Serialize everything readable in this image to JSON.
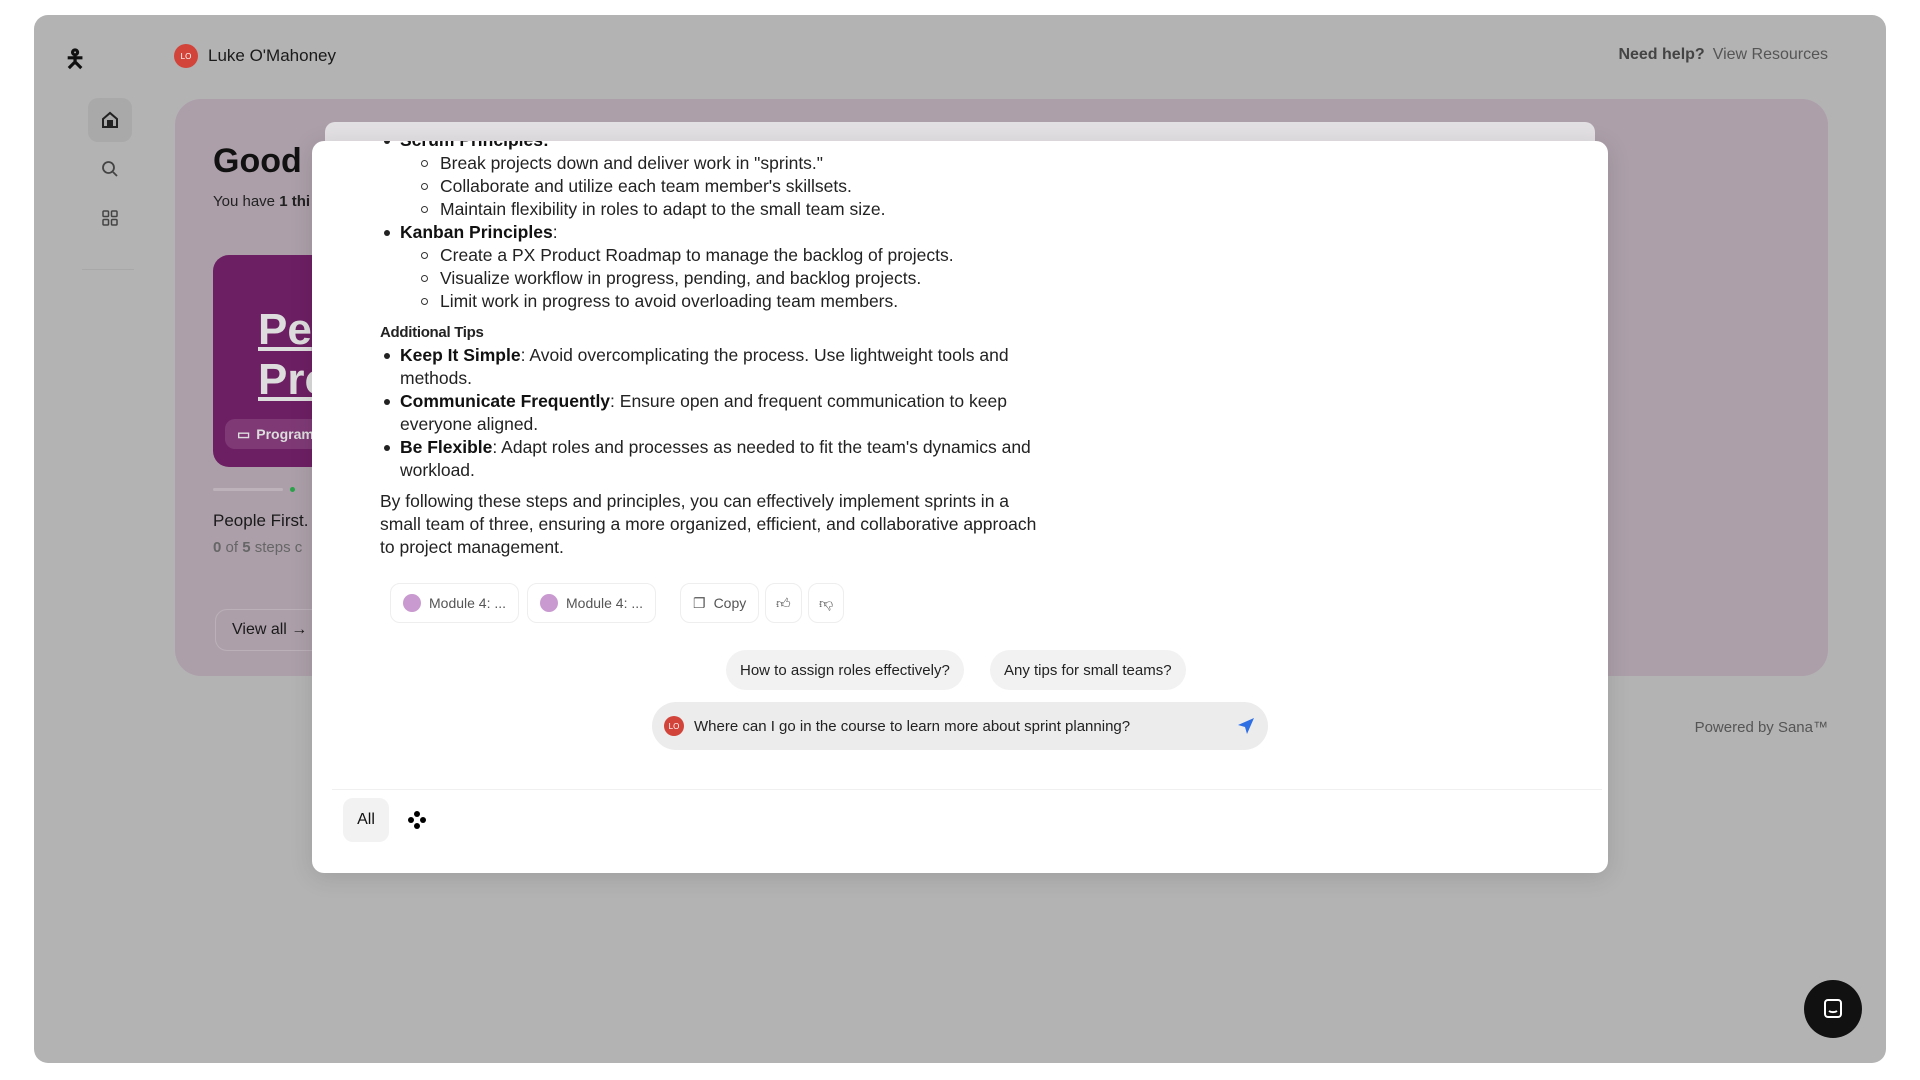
{
  "header": {
    "user_name": "Luke O'Mahoney",
    "user_initials": "LO",
    "help_label": "Need help?",
    "resources_link": "View Resources"
  },
  "sidebar": {
    "items": [
      {
        "icon": "home-icon"
      },
      {
        "icon": "search-icon"
      },
      {
        "icon": "grid-icon"
      }
    ]
  },
  "hero": {
    "greeting": "Good e",
    "subtitle_prefix": "You have ",
    "subtitle_bold": "1 thi",
    "course_title_line1": "Pe",
    "course_title_line2": "Pro",
    "course_tag": "Program",
    "course_name": "People First.",
    "steps_count": "0",
    "steps_of": " of ",
    "steps_total": "5",
    "steps_suffix": " steps c",
    "view_all": "View all",
    "progress_percent": 0
  },
  "chat": {
    "clipped_heading": "Scrum Principles:",
    "scrum": [
      "Break projects down and deliver work in \"sprints.\"",
      "Collaborate and utilize each team member's skillsets.",
      "Maintain flexibility in roles to adapt to the small team size."
    ],
    "kanban_heading": "Kanban Principles",
    "kanban": [
      "Create a PX Product Roadmap to manage the backlog of projects.",
      "Visualize workflow in progress, pending, and backlog projects.",
      "Limit work in progress to avoid overloading team members."
    ],
    "tips_heading": "Additional Tips",
    "tips": [
      {
        "bold": "Keep It Simple",
        "text": ": Avoid overcomplicating the process. Use lightweight tools and methods."
      },
      {
        "bold": "Communicate Frequently",
        "text": ": Ensure open and frequent communication to keep everyone aligned."
      },
      {
        "bold": "Be Flexible",
        "text": ": Adapt roles and processes as needed to fit the team's dynamics and workload."
      }
    ],
    "conclusion": "By following these steps and principles, you can effectively implement sprints in a small team of three, ensuring a more organized, efficient, and collaborative approach to project management.",
    "sources": [
      "Module 4: ...",
      "Module 4: ..."
    ],
    "copy_label": "Copy",
    "suggestions": [
      "How to assign roles effectively?",
      "Any tips for small teams?"
    ],
    "input_value": "Where can I go in the course to learn more about sprint planning?",
    "filter_all": "All"
  },
  "footer": {
    "powered_by": "Powered by Sana™"
  },
  "colors": {
    "accent": "#2f6fe4",
    "avatar": "#d2443a",
    "course_card": "#6d1f64"
  }
}
